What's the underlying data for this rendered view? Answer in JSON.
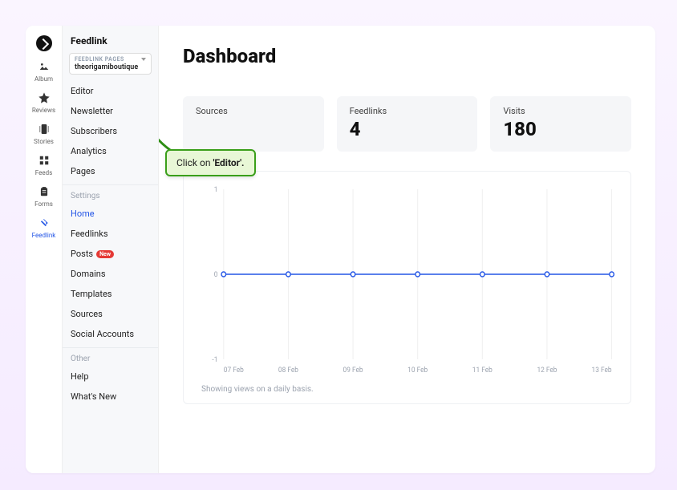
{
  "rail": {
    "items": [
      {
        "id": "logo"
      },
      {
        "id": "album",
        "label": "Album"
      },
      {
        "id": "reviews",
        "label": "Reviews"
      },
      {
        "id": "stories",
        "label": "Stories"
      },
      {
        "id": "feeds",
        "label": "Feeds"
      },
      {
        "id": "forms",
        "label": "Forms"
      },
      {
        "id": "feedlink",
        "label": "Feedlink",
        "active": true
      }
    ]
  },
  "sidebar": {
    "title": "Feedlink",
    "selector": {
      "label": "FEEDLINK PAGES",
      "value": "theorigamiboutique"
    },
    "main_items": [
      "Editor",
      "Newsletter",
      "Subscribers",
      "Analytics",
      "Pages"
    ],
    "settings_label": "Settings",
    "settings_items": [
      {
        "label": "Home",
        "active": true
      },
      {
        "label": "Feedlinks"
      },
      {
        "label": "Posts",
        "badge": "New"
      },
      {
        "label": "Domains"
      },
      {
        "label": "Templates"
      },
      {
        "label": "Sources"
      },
      {
        "label": "Social Accounts"
      }
    ],
    "other_label": "Other",
    "other_items": [
      "Help",
      "What's New"
    ]
  },
  "main": {
    "title": "Dashboard",
    "stats": [
      {
        "label": "Sources",
        "value": ""
      },
      {
        "label": "Feedlinks",
        "value": "4"
      },
      {
        "label": "Visits",
        "value": "180"
      }
    ],
    "caption": "Showing views on a daily basis."
  },
  "callout": {
    "prefix": "Click on ",
    "target": "'Editor'."
  },
  "chart_data": {
    "type": "line",
    "x": [
      "07 Feb",
      "08 Feb",
      "09 Feb",
      "10 Feb",
      "11 Feb",
      "12 Feb",
      "13 Feb"
    ],
    "series": [
      {
        "name": "views",
        "values": [
          0,
          0,
          0,
          0,
          0,
          0,
          0
        ]
      }
    ],
    "ylim": [
      -1,
      1
    ],
    "yticks": [
      1,
      0,
      -1
    ],
    "title": "",
    "xlabel": "",
    "ylabel": ""
  }
}
